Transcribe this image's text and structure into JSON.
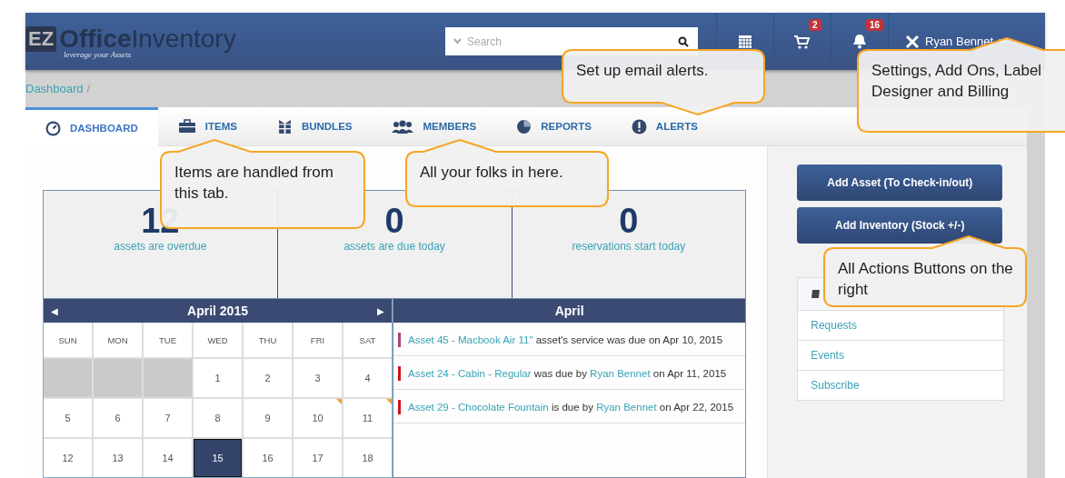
{
  "header": {
    "logo": {
      "badge": "EZ",
      "bold": "Office",
      "light": "Inventory",
      "tagline": "leverage your Assets"
    },
    "search": {
      "placeholder": "Search"
    },
    "icons": [
      {
        "kind": "calendar"
      },
      {
        "kind": "cart",
        "badge": "2"
      },
      {
        "kind": "bell",
        "badge": "16"
      }
    ],
    "user": {
      "name": "Ryan Bennet"
    }
  },
  "breadcrumb": [
    "Dashboard",
    "/"
  ],
  "tabs": [
    {
      "label": "DASHBOARD",
      "kind": "gauge",
      "selected": true
    },
    {
      "label": "ITEMS",
      "kind": "briefcase",
      "selected": false
    },
    {
      "label": "BUNDLES",
      "kind": "gift",
      "selected": false
    },
    {
      "label": "MEMBERS",
      "kind": "people",
      "selected": false
    },
    {
      "label": "REPORTS",
      "kind": "pie",
      "selected": false
    },
    {
      "label": "ALERTS",
      "kind": "alert",
      "selected": false
    }
  ],
  "stats": [
    {
      "value": "12",
      "label": "assets are overdue"
    },
    {
      "value": "0",
      "label": "assets are due today"
    },
    {
      "value": "0",
      "label": "reservations start today"
    }
  ],
  "calendar": {
    "title": "April 2015",
    "prev": "◀",
    "next": "▶",
    "weekdays": [
      "SUN",
      "MON",
      "TUE",
      "WED",
      "THU",
      "FRI",
      "SAT"
    ],
    "days": [
      {
        "kind": "blank"
      },
      {
        "kind": "blank"
      },
      {
        "kind": "blank"
      },
      {
        "kind": "day",
        "label": "1",
        "selected": false,
        "event": false
      },
      {
        "kind": "day",
        "label": "2",
        "selected": false,
        "event": false
      },
      {
        "kind": "day",
        "label": "3",
        "selected": false,
        "event": false
      },
      {
        "kind": "day",
        "label": "4",
        "selected": false,
        "event": false
      },
      {
        "kind": "day",
        "label": "5",
        "selected": false,
        "event": false
      },
      {
        "kind": "day",
        "label": "6",
        "selected": false,
        "event": false
      },
      {
        "kind": "day",
        "label": "7",
        "selected": false,
        "event": false
      },
      {
        "kind": "day",
        "label": "8",
        "selected": false,
        "event": false
      },
      {
        "kind": "day",
        "label": "9",
        "selected": false,
        "event": false
      },
      {
        "kind": "day",
        "label": "10",
        "selected": false,
        "event": true
      },
      {
        "kind": "day",
        "label": "11",
        "selected": false,
        "event": true
      },
      {
        "kind": "day",
        "label": "12",
        "selected": false,
        "event": false
      },
      {
        "kind": "day",
        "label": "13",
        "selected": false,
        "event": false
      },
      {
        "kind": "day",
        "label": "14",
        "selected": false,
        "event": false
      },
      {
        "kind": "day",
        "label": "15",
        "selected": true,
        "event": false
      },
      {
        "kind": "day",
        "label": "16",
        "selected": false,
        "event": false
      },
      {
        "kind": "day",
        "label": "17",
        "selected": false,
        "event": false
      },
      {
        "kind": "day",
        "label": "18",
        "selected": false,
        "event": false
      }
    ]
  },
  "events": {
    "title": "April",
    "items": [
      {
        "color": "#a8457a",
        "parts": [
          {
            "kind": "link",
            "text": "Asset 45 - Macbook Air 11\""
          },
          {
            "kind": "text",
            "text": "asset's service was due on Apr 10, 2015"
          }
        ]
      },
      {
        "color": "#d0101b",
        "parts": [
          {
            "kind": "link",
            "text": "Asset 24 - Cabin - Regular"
          },
          {
            "kind": "text",
            "text": "was due by"
          },
          {
            "kind": "link",
            "text": "Ryan Bennet"
          },
          {
            "kind": "text",
            "text": "on Apr 11, 2015"
          }
        ]
      },
      {
        "color": "#d0101b",
        "parts": [
          {
            "kind": "link",
            "text": "Asset 29 - Chocolate Fountain"
          },
          {
            "kind": "text",
            "text": "is due by"
          },
          {
            "kind": "link",
            "text": "Ryan Bennet"
          },
          {
            "kind": "text",
            "text": "on Apr 22, 2015"
          }
        ]
      }
    ]
  },
  "actions": [
    "Add Asset (To Check-in/out)",
    "Add Inventory (Stock +/-)"
  ],
  "side_panel": {
    "links": [
      "Requests",
      "Events",
      "Subscribe"
    ]
  },
  "callouts": [
    {
      "text": "Set up email alerts."
    },
    {
      "text": "Settings, Add Ons, Label Designer and Billing"
    },
    {
      "text": "Items are handled from this tab."
    },
    {
      "text": "All your folks in here."
    },
    {
      "text": "All Actions Buttons on the right"
    }
  ]
}
